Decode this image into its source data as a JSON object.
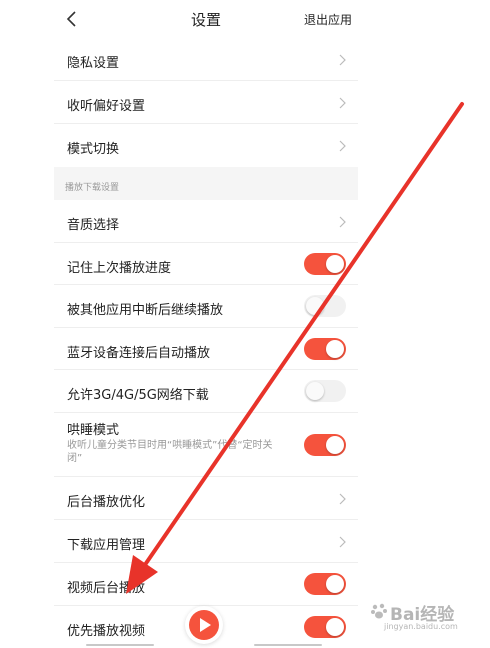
{
  "header": {
    "title": "设置",
    "quit_label": "退出应用"
  },
  "rows": {
    "privacy": "隐私设置",
    "listen_pref": "收听偏好设置",
    "mode_switch": "模式切换",
    "section_playback": "播放下载设置",
    "audio_quality": "音质选择",
    "remember_progress": "记住上次播放进度",
    "resume_after_interrupt": "被其他应用中断后继续播放",
    "bluetooth_autoplay": "蓝牙设备连接后自动播放",
    "cellular_download": "允许3G/4G/5G网络下载",
    "sleep_mode": "哄睡模式",
    "sleep_mode_desc": "收听儿童分类节目时用“哄睡模式”代替“定时关闭”",
    "bg_optimize": "后台播放优化",
    "download_manage": "下载应用管理",
    "video_bg_play": "视频后台播放",
    "prefer_video": "优先播放视频"
  },
  "toggles": {
    "remember_progress": true,
    "resume_after_interrupt": false,
    "bluetooth_autoplay": true,
    "cellular_download": false,
    "sleep_mode": true,
    "video_bg_play": true,
    "prefer_video": true
  },
  "colors": {
    "accent": "#f5533d",
    "arrow": "#e8332a"
  },
  "icons": {
    "back": "chevron-left-icon",
    "row_arrow": "chevron-right-icon",
    "play": "play-icon"
  },
  "watermark": {
    "brand": "Bai经验",
    "url": "jingyan.baidu.com"
  }
}
